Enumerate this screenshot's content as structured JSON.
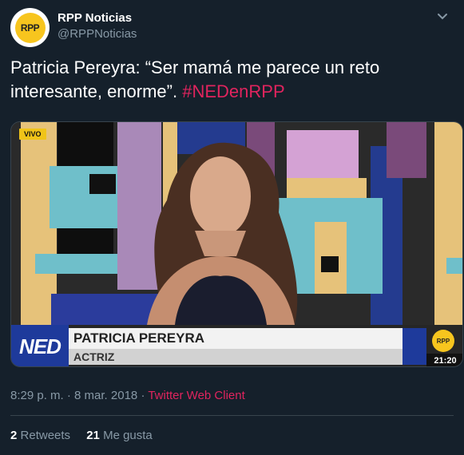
{
  "author": {
    "avatar_text": "RPP",
    "name": "RPP Noticias",
    "handle": "@RPPNoticias"
  },
  "tweet": {
    "text": "Patricia Pereyra: “Ser mamá me parece un reto interesante, enorme”.",
    "hashtag": "#NEDenRPP"
  },
  "media": {
    "live_badge": "VIVO",
    "show_logo": "NED",
    "guest_name": "PATRICIA PEREYRA",
    "guest_role": "ACTRIZ",
    "channel_badge": "RPP",
    "clock": "21:20"
  },
  "meta": {
    "timestamp": "8:29 p. m. · 8 mar. 2018",
    "separator": "·",
    "client": "Twitter Web Client"
  },
  "stats": {
    "retweets_count": "2",
    "retweets_label": "Retweets",
    "likes_count": "21",
    "likes_label": "Me gusta"
  },
  "colors": {
    "background": "#15202b",
    "hashtag": "#e0245e",
    "muted": "#8899a6",
    "brand_yellow": "#f7c51e",
    "ned_blue": "#1e3a9b"
  },
  "icons": {
    "menu": "chevron-down-icon"
  }
}
